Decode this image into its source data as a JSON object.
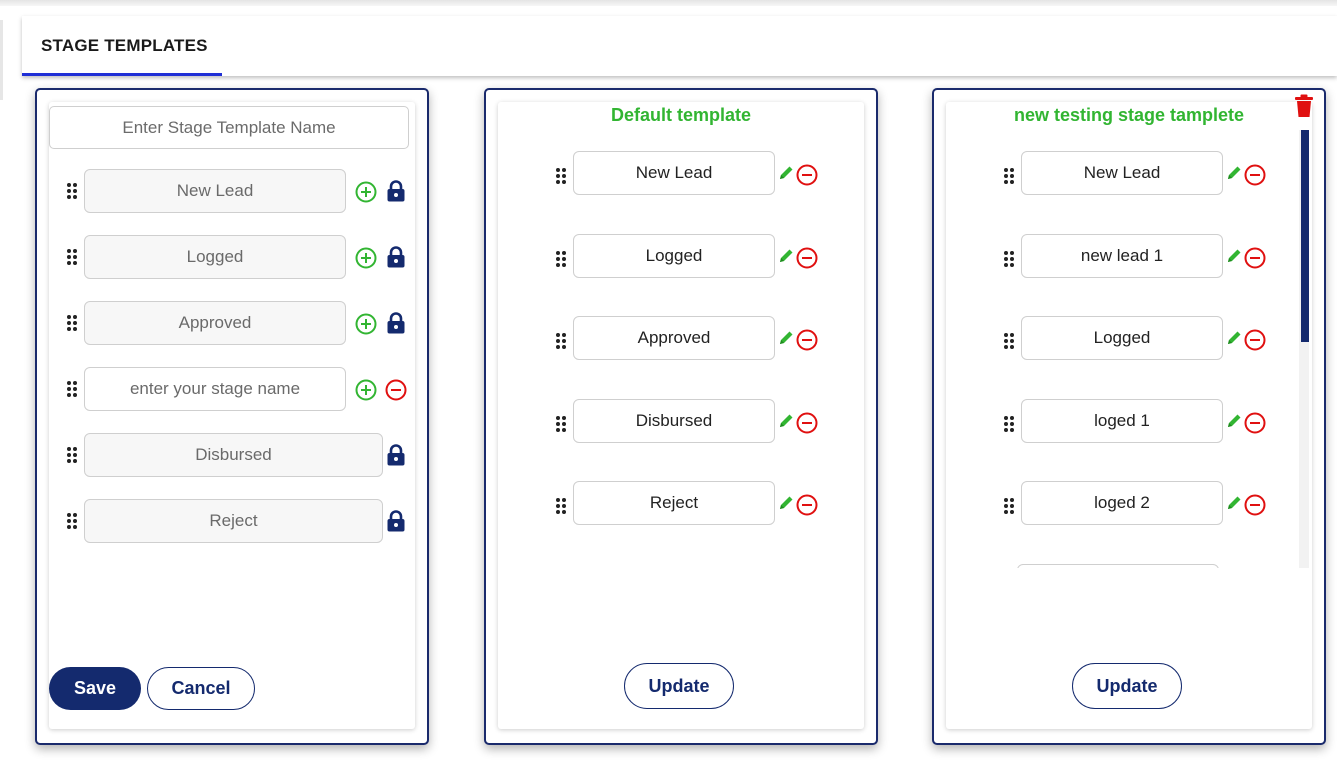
{
  "header": {
    "tab_label": "STAGE TEMPLATES"
  },
  "new_template": {
    "name_placeholder": "Enter Stage Template Name",
    "stages": [
      {
        "label": "New Lead",
        "kind": "fixed",
        "actions": [
          "add",
          "lock"
        ]
      },
      {
        "label": "Logged",
        "kind": "fixed",
        "actions": [
          "add",
          "lock"
        ]
      },
      {
        "label": "Approved",
        "kind": "fixed",
        "actions": [
          "add",
          "lock"
        ]
      },
      {
        "placeholder": "enter your stage name",
        "kind": "input",
        "actions": [
          "add",
          "remove"
        ]
      },
      {
        "label": "Disbursed",
        "kind": "fixed",
        "actions": [
          "lock"
        ]
      },
      {
        "label": "Reject",
        "kind": "fixed",
        "actions": [
          "lock"
        ]
      }
    ],
    "save_label": "Save",
    "cancel_label": "Cancel"
  },
  "templates": [
    {
      "title": "Default template",
      "stages": [
        "New Lead",
        "Logged",
        "Approved",
        "Disbursed",
        "Reject"
      ],
      "update_label": "Update"
    },
    {
      "title": "new testing stage tamplete",
      "stages": [
        "New Lead",
        "new lead 1",
        "Logged",
        "loged 1",
        "loged 2"
      ],
      "update_label": "Update"
    }
  ],
  "icons": {
    "grip": "drag-handle-icon",
    "add": "plus-circle-icon",
    "lock": "lock-icon",
    "remove": "minus-circle-icon",
    "edit": "pencil-icon",
    "delete": "trash-icon"
  },
  "colors": {
    "navy": "#142a6e",
    "green": "#32b532",
    "red": "#e01010",
    "tab_underline": "#1f2fd6"
  }
}
